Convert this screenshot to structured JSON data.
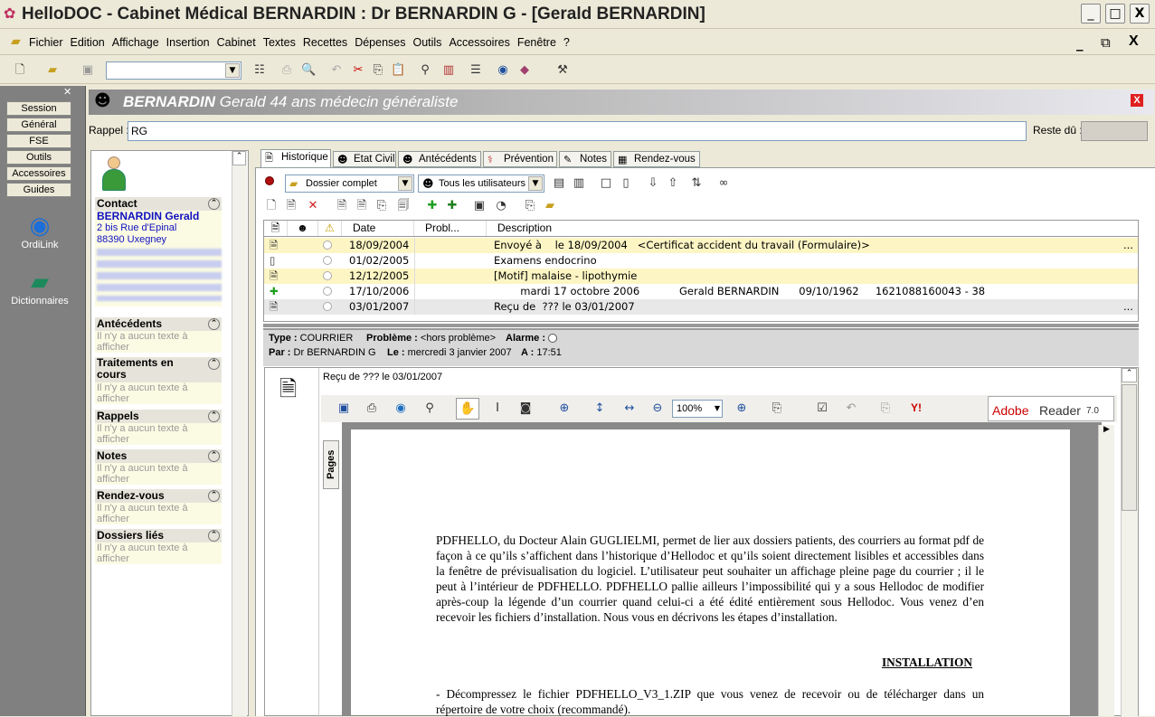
{
  "window": {
    "title": "HelloDOC - Cabinet Médical BERNARDIN : Dr BERNARDIN G - [Gerald BERNARDIN]",
    "min": "_",
    "max": "□",
    "close": "X"
  },
  "menu": [
    "Fichier",
    "Edition",
    "Affichage",
    "Insertion",
    "Cabinet",
    "Textes",
    "Recettes",
    "Dépenses",
    "Outils",
    "Accessoires",
    "Fenêtre",
    "?"
  ],
  "leftbar": {
    "buttons": [
      "Session",
      "Général",
      "FSE",
      "Outils",
      "Accessoires",
      "Guides"
    ],
    "tools": [
      "OrdiLink",
      "Dictionnaires"
    ]
  },
  "patient": {
    "name": "BERNARDIN",
    "info": "Gerald 44 ans médecin généraliste",
    "close": "X"
  },
  "rappel": {
    "label": "Rappel :",
    "value": "RG"
  },
  "reste": {
    "label": "Reste dû :",
    "value": ""
  },
  "contact": {
    "title": "Contact",
    "name": "BERNARDIN Gerald",
    "address1": "2 bis Rue d'Epinal",
    "address2": "88390 Uxegney"
  },
  "sections": [
    {
      "title": "Antécédents",
      "empty": "Il n'y a aucun texte à afficher"
    },
    {
      "title": "Traitements en cours",
      "empty": "Il n'y a aucun texte à afficher"
    },
    {
      "title": "Rappels",
      "empty": "Il n'y a aucun texte à afficher"
    },
    {
      "title": "Notes",
      "empty": "Il n'y a aucun texte à afficher"
    },
    {
      "title": "Rendez-vous",
      "empty": "Il n'y a aucun texte à afficher"
    },
    {
      "title": "Dossiers liés",
      "empty": "Il n'y a aucun texte à afficher"
    }
  ],
  "tabs": [
    "Historique",
    "Etat Civil",
    "Antécédents",
    "Prévention",
    "Notes",
    "Rendez-vous"
  ],
  "filters": {
    "dossier": "Dossier complet",
    "users": "Tous les utilisateurs"
  },
  "grid": {
    "headers": [
      "Date",
      "Probl...",
      "Description"
    ],
    "rows": [
      {
        "date": "18/09/2004",
        "desc": "Envoyé à    le 18/09/2004   <Certificat accident du travail (Formulaire)>",
        "more": "..."
      },
      {
        "date": "01/02/2005",
        "desc": "Examens endocrino",
        "more": ""
      },
      {
        "date": "12/12/2005",
        "desc": "[Motif] malaise - lipothymie",
        "more": ""
      },
      {
        "date": "17/10/2006",
        "desc": "        mardi 17 octobre 2006            Gerald BERNARDIN      09/10/1962     1621088160043 - 38",
        "more": ""
      },
      {
        "date": "03/01/2007",
        "desc": "Reçu de  ??? le 03/01/2007",
        "more": "..."
      }
    ]
  },
  "detail": {
    "type_label": "Type :",
    "type": "COURRIER",
    "prob_label": "Problème :",
    "prob": "<hors problème>",
    "alarm_label": "Alarme :",
    "par_label": "Par :",
    "par": "Dr BERNARDIN G",
    "le_label": "Le :",
    "le": "mercredi 3 janvier 2007",
    "a_label": "A :",
    "a": "17:51"
  },
  "preview": {
    "title": "Reçu de ??? le 03/01/2007",
    "zoom": "100%",
    "pages_tab": "Pages",
    "adobe": "Adobe",
    "reader": "Reader",
    "version": "7.0",
    "para1": "PDFHELLO, du Docteur Alain GUGLIELMI, permet de lier aux dossiers patients, des courriers au format pdf de façon à ce qu’ils s’affichent dans l’historique d’Hellodoc et qu’ils soient directement lisibles et accessibles dans la fenêtre de prévisualisation du logiciel. L’utilisateur peut souhaiter un affichage pleine page du courrier ; il le peut à l’intérieur de PDFHELLO. PDFHELLO pallie ailleurs l’impossibilité qui y a sous Hellodoc de modifier après-coup la légende d’un courrier quand celui-ci a été édité entièrement sous Hellodoc. Vous venez d’en recevoir les fichiers d’installation. Nous vous en décrivons les étapes d’installation.",
    "heading": "INSTALLATION",
    "para2": "- Décompressez le fichier PDFHELLO_V3_1.ZIP que vous venez de recevoir ou de télécharger dans un répertoire de votre choix (recommandé)."
  }
}
